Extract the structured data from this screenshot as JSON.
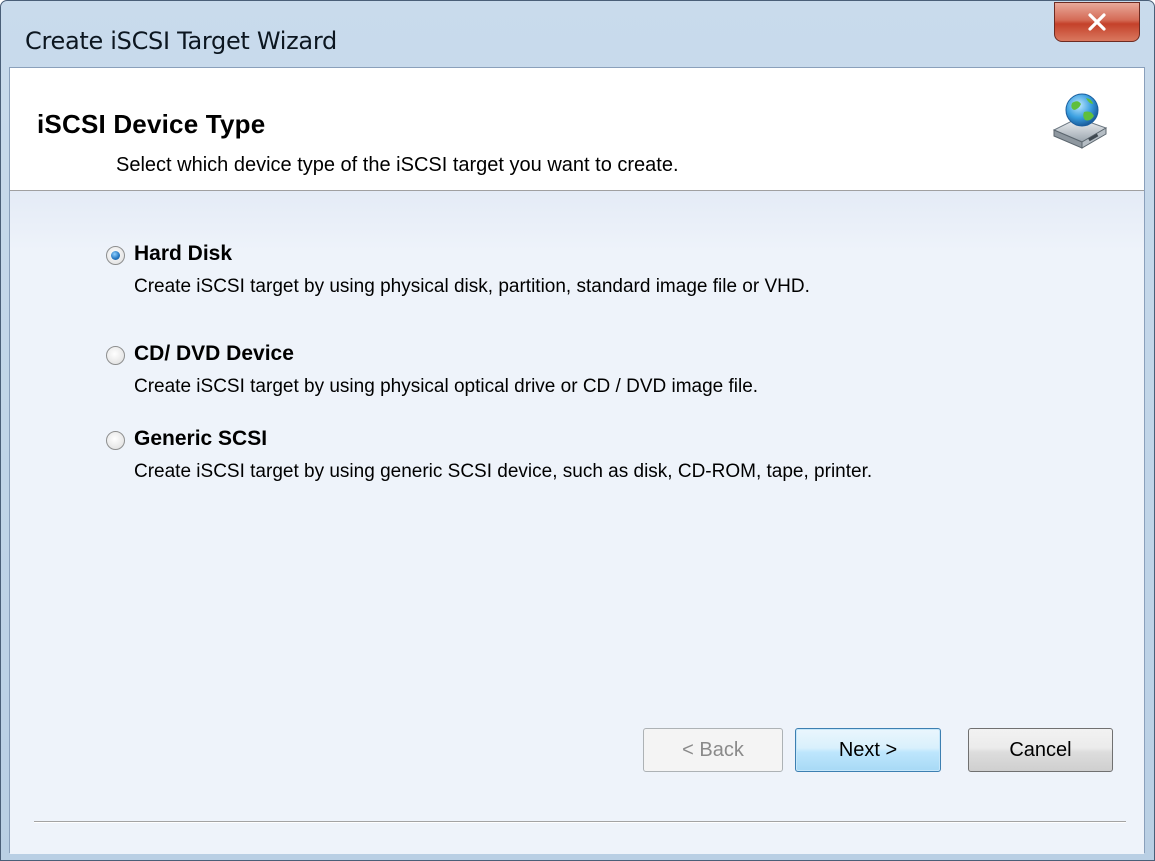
{
  "window": {
    "title": "Create iSCSI Target Wizard",
    "close_label": "x"
  },
  "header": {
    "title": "iSCSI Device Type",
    "subtitle": "Select which device type of the iSCSI target you want to create.",
    "icon": "network-disk-icon"
  },
  "options": [
    {
      "label": "Hard Disk",
      "description": "Create iSCSI target by using physical disk, partition, standard image file or VHD.",
      "selected": true
    },
    {
      "label": "CD/ DVD Device",
      "description": "Create iSCSI target by using physical optical drive or CD / DVD image file.",
      "selected": false
    },
    {
      "label": "Generic SCSI",
      "description": "Create iSCSI target by using generic SCSI device, such as disk, CD-ROM, tape, printer.",
      "selected": false
    }
  ],
  "buttons": {
    "back": "< Back",
    "next": "Next >",
    "cancel": "Cancel"
  },
  "colors": {
    "accent": "#3c7fb1",
    "close_red": "#c4412a",
    "window_frame": "#c9dbec"
  }
}
